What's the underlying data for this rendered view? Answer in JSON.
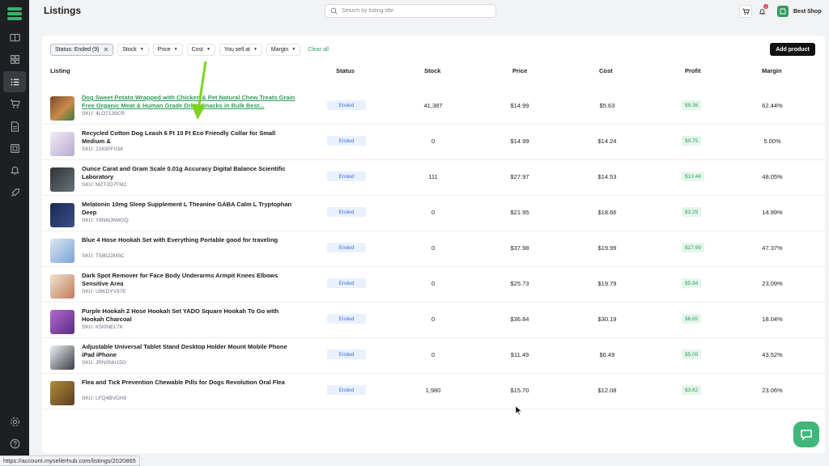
{
  "header": {
    "title": "Listings",
    "search_placeholder": "Search by listing title",
    "notification_count": "1",
    "shop_name": "Best Shop"
  },
  "filters": {
    "status_chip": "Status: Ended (9)",
    "stock": "Stock",
    "price": "Price",
    "cost": "Cost",
    "you_sell_at": "You sell at",
    "margin": "Margin",
    "clear_all": "Clear all",
    "add_product": "Add product"
  },
  "columns": {
    "listing": "Listing",
    "status": "Status",
    "stock": "Stock",
    "price": "Price",
    "cost": "Cost",
    "profit": "Profit",
    "margin": "Margin"
  },
  "rows": [
    {
      "title": "Dog Sweet Potato Wrapped with Chicken & Pet Natural Chew Treats Grain Free Organic Meat & Human Grade Dried Snacks in Bulk Best...",
      "sku": "SKU: 4LO7139CR",
      "status": "Ended",
      "stock": "41,387",
      "price": "$14.99",
      "cost": "$5.63",
      "profit": "$9.36",
      "margin": "62.44%"
    },
    {
      "title": "Recycled Cotton Dog Leash 6 Ft 10 Ft Eco Friendly Collar for Small Medium &",
      "sku": "SKU: 2283PF034",
      "status": "Ended",
      "stock": "0",
      "price": "$14.99",
      "cost": "$14.24",
      "profit": "$0.75",
      "margin": "5.00%"
    },
    {
      "title": "Ounce Carat and Gram Scale 0.01g Accuracy Digital Balance Scientific Laboratory",
      "sku": "SKU: MZT2D7FM2",
      "status": "Ended",
      "stock": "111",
      "price": "$27.97",
      "cost": "$14.53",
      "profit": "$13.44",
      "margin": "48.05%"
    },
    {
      "title": "Melatonin 10mg Sleep Supplement L Theanine GABA Calm L Tryptophan Deep",
      "sku": "SKU: Y8N6ONW2Q",
      "status": "Ended",
      "stock": "0",
      "price": "$21.95",
      "cost": "$18.66",
      "profit": "$3.29",
      "margin": "14.99%"
    },
    {
      "title": "Blue 4 Hose Hookah Set with Everything Portable good for traveling",
      "sku": "SKU: T58522M5C",
      "status": "Ended",
      "stock": "0",
      "price": "$37.98",
      "cost": "$19.99",
      "profit": "$17.99",
      "margin": "47.37%"
    },
    {
      "title": "Dark Spot Remover for Face Body Underarms Armpit Knees Elbows Sensitive Area",
      "sku": "SKU: U8KDYV97E",
      "status": "Ended",
      "stock": "0",
      "price": "$25.73",
      "cost": "$19.79",
      "profit": "$5.94",
      "margin": "23.09%"
    },
    {
      "title": "Purple Hookah 2 Hose Hookah Set YADO Square Hookah To Go with Hookah Charcoal",
      "sku": "SKU: K5I0NEL7K",
      "status": "Ended",
      "stock": "0",
      "price": "$36.84",
      "cost": "$30.19",
      "profit": "$6.65",
      "margin": "18.04%"
    },
    {
      "title": "Adjustable Universal Tablet Stand Desktop Holder Mount Mobile Phone iPad iPhone",
      "sku": "SKU: JRN0NH15G",
      "status": "Ended",
      "stock": "0",
      "price": "$11.49",
      "cost": "$6.49",
      "profit": "$5.00",
      "margin": "43.52%"
    },
    {
      "title": "Flea and Tick Prevention Chewable Pills for Dogs Revolution Oral Flea",
      "sku": "SKU: LFQ4BVGH9",
      "status": "Ended",
      "stock": "1,980",
      "price": "$15.70",
      "cost": "$12.08",
      "profit": "$3.62",
      "margin": "23.06%"
    }
  ],
  "footer": {
    "url": "https://account.mysellerhub.com/listings/2020865"
  },
  "colors": {
    "accent": "#2f9e5b",
    "sidebar": "#1e1f22",
    "status_bg": "#e9f0fe",
    "status_text": "#3b6fe0",
    "annotation_arrow": "#7ed321"
  }
}
